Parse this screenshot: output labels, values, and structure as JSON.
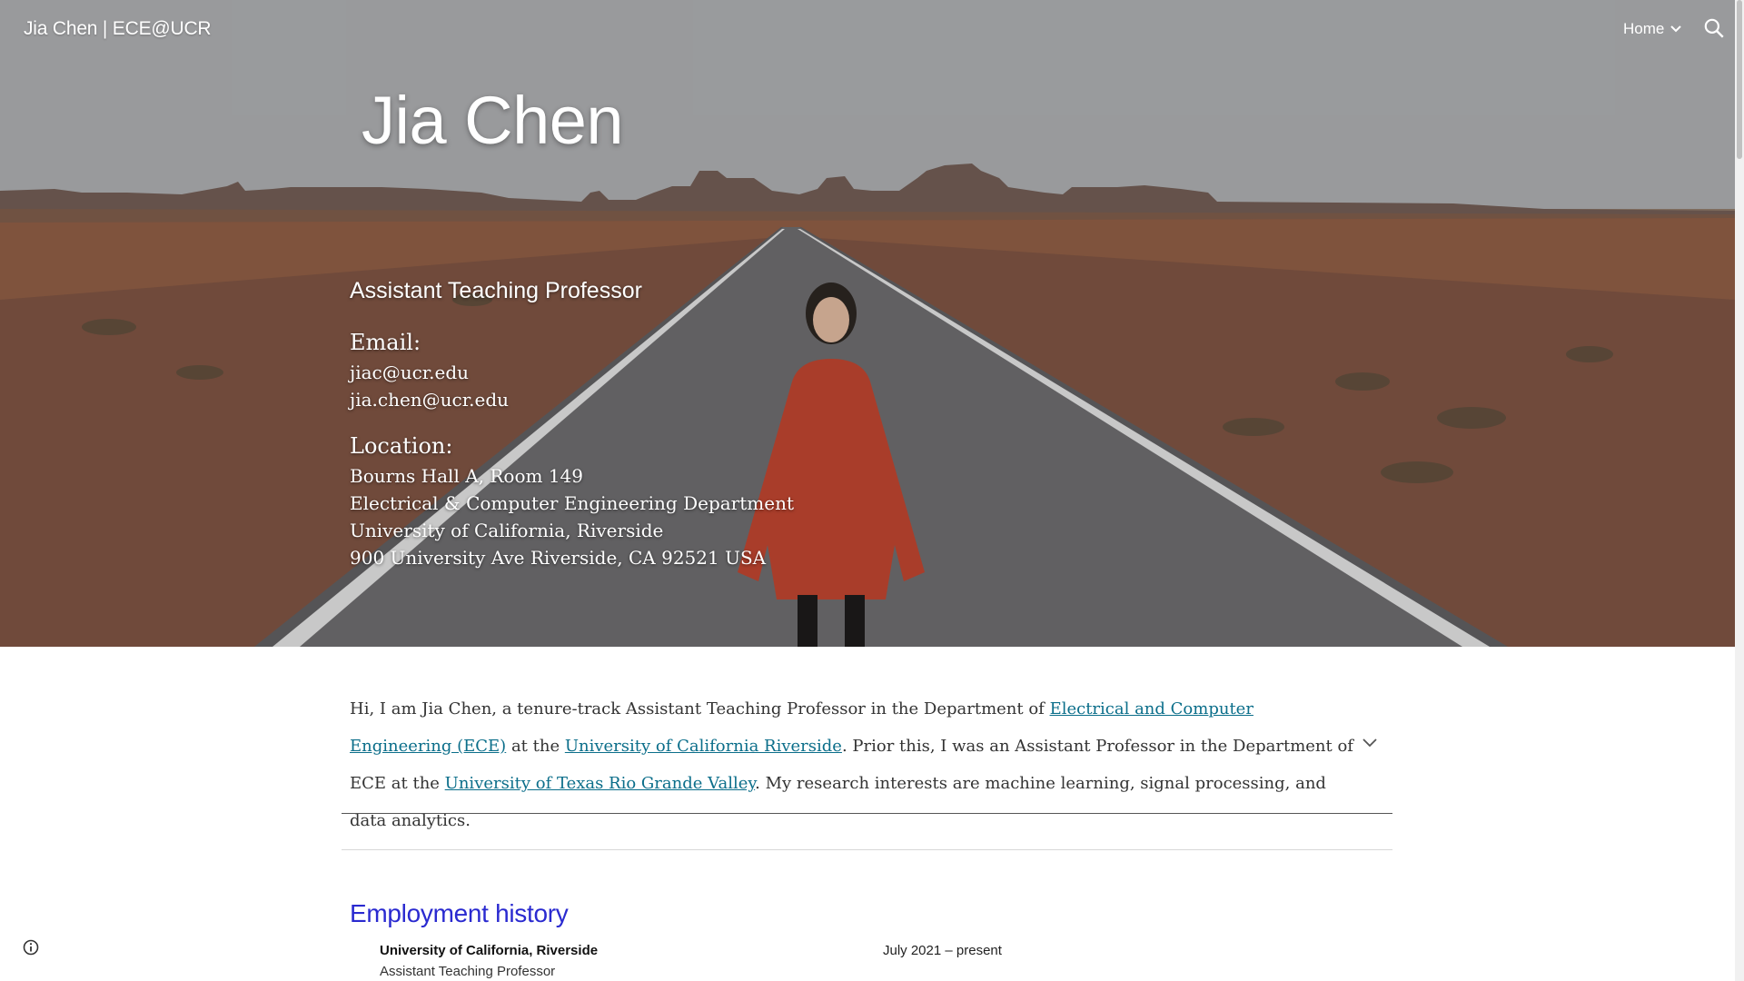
{
  "header": {
    "site_title": "Jia Chen | ECE@UCR",
    "nav_home": "Home",
    "search_icon": "search-icon",
    "chevron_icon": "chevron-down-icon"
  },
  "hero": {
    "name": "Jia Chen",
    "role": "Assistant Teaching Professor",
    "email_heading": "Email:",
    "emails": [
      "jiac@ucr.edu",
      "jia.chen@ucr.edu"
    ],
    "location_heading": "Location:",
    "location_lines": [
      "Bourns Hall A, Room 149",
      "Electrical & Computer Engineering Department",
      "University of California, Riverside",
      "900 University Ave Riverside, CA 92521 USA"
    ]
  },
  "intro": {
    "t1": "Hi, I am Jia Chen, a tenure-track Assistant Teaching Professor in the Department of ",
    "link1": "Electrical and Computer Engineering (ECE)",
    "t2": " at the ",
    "link2": "University of California Riverside",
    "t3": ". Prior this, I was an Assistant Professor in the Department of ECE at the ",
    "link3": "University of Texas Rio Grande Valley",
    "t4": ". My research interests are machine learning, signal processing, and data analytics."
  },
  "employment": {
    "title": "Employment history",
    "items": [
      {
        "org": "University of California, Riverside",
        "role": "Assistant Teaching Professor",
        "dates": "July 2021 – present"
      }
    ]
  },
  "colors": {
    "link": "#0b6e8a",
    "section_title": "#2a2ad0",
    "body_text": "#333333"
  }
}
